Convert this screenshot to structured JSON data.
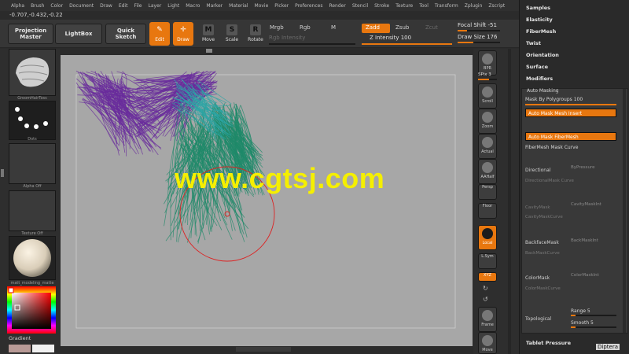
{
  "menu": [
    "Alpha",
    "Brush",
    "Color",
    "Document",
    "Draw",
    "Edit",
    "File",
    "Layer",
    "Light",
    "Macro",
    "Marker",
    "Material",
    "Movie",
    "Picker",
    "Preferences",
    "Render",
    "Stencil",
    "Stroke",
    "Texture",
    "Tool",
    "Transform",
    "Zplugin",
    "Zscript"
  ],
  "coords": "-0.707,-0.432,-0.22",
  "toolbar": {
    "projection_master": "Projection Master",
    "lightbox": "LightBox",
    "quick_sketch": "Quick Sketch",
    "edit": "Edit",
    "draw": "Draw",
    "move": "Move",
    "scale": "Scale",
    "rotate": "Rotate",
    "mrgb": "Mrgb",
    "rgb": "Rgb",
    "m": "M",
    "zadd": "Zadd",
    "zsub": "Zsub",
    "zcut": "Zcut",
    "rgb_intensity": "Rgb Intensity",
    "z_intensity": "Z Intensity 100",
    "focal_shift": "Focal Shift -51",
    "draw_size": "Draw Size 176"
  },
  "left_shelf": {
    "brush_label": "GroomHairToss",
    "dots_label": "Dots",
    "alpha_label": "Alpha Off",
    "texture_label": "Texture Off",
    "material_label": "matt_modeling_matte",
    "gradient_label": "Gradient"
  },
  "right_shelf": {
    "bpr": "BPR",
    "spix": "SPix 3",
    "scroll": "Scroll",
    "zoom": "Zoom",
    "actual": "Actual",
    "aahalf": "AAHalf",
    "persp": "Persp",
    "floor": "Floor",
    "local": "Local",
    "lsym": "L.Sym",
    "xyz": "XYZ",
    "frame": "Frame",
    "move": "Move"
  },
  "palette": {
    "sections": [
      "Samples",
      "Elasticity",
      "FiberMesh",
      "Twist",
      "Orientation",
      "Surface",
      "Modifiers"
    ],
    "auto_masking": "Auto Masking",
    "mask_by_polygroups": "Mask By Polygroups 100",
    "auto_mask_mesh_insert": "Auto Mask Mesh Insert",
    "auto_mask_fibermesh": "Auto Mask FiberMesh",
    "fibermesh_mask_curve": "FiberMesh Mask Curve",
    "directional": "Directional",
    "by_pressure": "ByPressure",
    "directional_mask_curve": "DirectionalMask Curve",
    "cavity_mask": "CavityMask",
    "cavity_mask_int": "CavityMaskInt",
    "cavity_mask_curve": "CavityMaskCurve",
    "backface_mask": "BackfaceMask",
    "back_mask_int": "BackMaskInt",
    "back_mask_curve": "BackMaskCurve",
    "color_mask": "ColorMask",
    "color_mask_int": "ColorMaskInt",
    "color_mask_curve": "ColorMaskCurve",
    "topological": "Topological",
    "range": "Range 5",
    "smooth": "Smooth 5",
    "tablet_pressure": "Tablet Pressure"
  },
  "watermark": "www.cgtsj.com",
  "corner_label": "Diptera",
  "colors": {
    "accent": "#e8770f",
    "canvas": "#a7a7a7",
    "purple_hair": "#6a2c9c",
    "green_hair": "#1f8a6a",
    "teal_hair": "#2ba6a6"
  }
}
